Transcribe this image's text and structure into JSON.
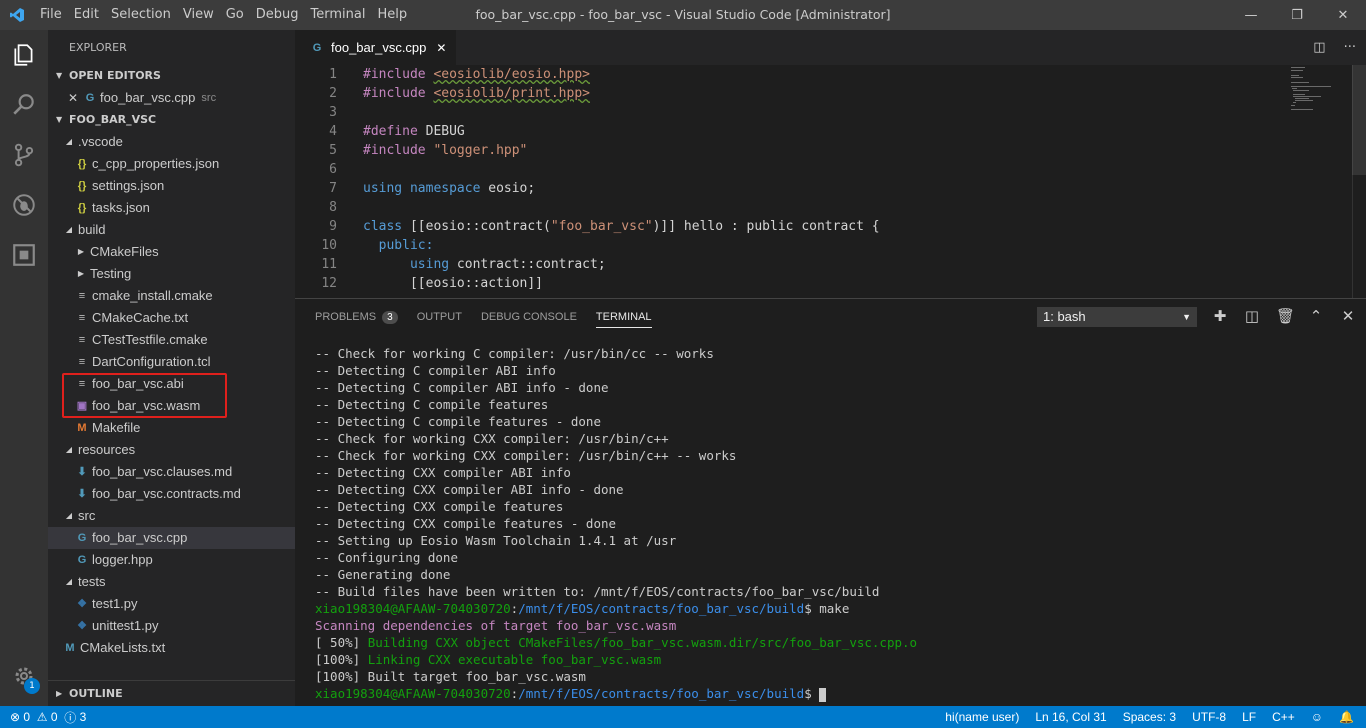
{
  "titlebar": {
    "menu": [
      "File",
      "Edit",
      "Selection",
      "View",
      "Go",
      "Debug",
      "Terminal",
      "Help"
    ],
    "title": "foo_bar_vsc.cpp - foo_bar_vsc - Visual Studio Code [Administrator]"
  },
  "activitybar": {
    "icons": [
      "explorer-icon",
      "search-icon",
      "source-control-icon",
      "debug-icon",
      "extensions-icon"
    ],
    "settings_badge": "1"
  },
  "sidebar": {
    "title": "EXPLORER",
    "open_editors_label": "OPEN EDITORS",
    "open_editor_file": "foo_bar_vsc.cpp",
    "open_editor_dir": "src",
    "project_label": "FOO_BAR_VSC",
    "tree": [
      {
        "label": ".vscode",
        "type": "folder-open",
        "depth": 1
      },
      {
        "label": "c_cpp_properties.json",
        "type": "json",
        "depth": 2
      },
      {
        "label": "settings.json",
        "type": "json",
        "depth": 2
      },
      {
        "label": "tasks.json",
        "type": "json",
        "depth": 2
      },
      {
        "label": "build",
        "type": "folder-open",
        "depth": 1
      },
      {
        "label": "CMakeFiles",
        "type": "folder-closed",
        "depth": 2
      },
      {
        "label": "Testing",
        "type": "folder-closed",
        "depth": 2
      },
      {
        "label": "cmake_install.cmake",
        "type": "lines",
        "depth": 2
      },
      {
        "label": "CMakeCache.txt",
        "type": "lines",
        "depth": 2
      },
      {
        "label": "CTestTestfile.cmake",
        "type": "lines",
        "depth": 2
      },
      {
        "label": "DartConfiguration.tcl",
        "type": "lines",
        "depth": 2
      },
      {
        "label": "foo_bar_vsc.abi",
        "type": "lines",
        "depth": 2
      },
      {
        "label": "foo_bar_vsc.wasm",
        "type": "wasm",
        "depth": 2
      },
      {
        "label": "Makefile",
        "type": "make",
        "depth": 2
      },
      {
        "label": "resources",
        "type": "folder-open",
        "depth": 1
      },
      {
        "label": "foo_bar_vsc.clauses.md",
        "type": "md",
        "depth": 2
      },
      {
        "label": "foo_bar_vsc.contracts.md",
        "type": "md",
        "depth": 2
      },
      {
        "label": "src",
        "type": "folder-open",
        "depth": 1
      },
      {
        "label": "foo_bar_vsc.cpp",
        "type": "cpp",
        "depth": 2,
        "active": true
      },
      {
        "label": "logger.hpp",
        "type": "cpp",
        "depth": 2
      },
      {
        "label": "tests",
        "type": "folder-open",
        "depth": 1
      },
      {
        "label": "test1.py",
        "type": "py",
        "depth": 2
      },
      {
        "label": "unittest1.py",
        "type": "py",
        "depth": 2
      },
      {
        "label": "CMakeLists.txt",
        "type": "cmake",
        "depth": 1
      }
    ],
    "outline_label": "OUTLINE"
  },
  "editor": {
    "tab_label": "foo_bar_vsc.cpp",
    "lines": [
      {
        "n": "1",
        "html": "<span class=\"k-purp\">#include</span> <span class=\"k-str squig\">&lt;eosiolib/eosio.hpp&gt;</span>"
      },
      {
        "n": "2",
        "html": "<span class=\"k-purp\">#include</span> <span class=\"k-str squig\">&lt;eosiolib/print.hpp&gt;</span>"
      },
      {
        "n": "3",
        "html": ""
      },
      {
        "n": "4",
        "html": "<span class=\"k-purp\">#define</span> DEBUG"
      },
      {
        "n": "5",
        "html": "<span class=\"k-purp\">#include</span> <span class=\"k-str\">\"logger.hpp\"</span>"
      },
      {
        "n": "6",
        "html": ""
      },
      {
        "n": "7",
        "html": "<span class=\"k-blue\">using</span> <span class=\"k-blue\">namespace</span> eosio;"
      },
      {
        "n": "8",
        "html": ""
      },
      {
        "n": "9",
        "html": "<span class=\"k-blue\">class</span> [[eosio::contract(<span class=\"k-str\">\"foo_bar_vsc\"</span>)]] hello : public contract {"
      },
      {
        "n": "10",
        "html": "  <span class=\"k-blue\">public:</span>"
      },
      {
        "n": "11",
        "html": "      <span class=\"k-blue\">using</span> contract::contract;"
      },
      {
        "n": "12",
        "html": "      [[eosio::action]]"
      }
    ]
  },
  "panel": {
    "tabs": [
      "PROBLEMS",
      "OUTPUT",
      "DEBUG CONSOLE",
      "TERMINAL"
    ],
    "problems_count": "3",
    "terminal_select": "1: bash",
    "terminal_lines": [
      {
        "cls": "",
        "text": "-- Check for working C compiler: /usr/bin/cc -- works"
      },
      {
        "cls": "",
        "text": "-- Detecting C compiler ABI info"
      },
      {
        "cls": "",
        "text": "-- Detecting C compiler ABI info - done"
      },
      {
        "cls": "",
        "text": "-- Detecting C compile features"
      },
      {
        "cls": "",
        "text": "-- Detecting C compile features - done"
      },
      {
        "cls": "",
        "text": "-- Check for working CXX compiler: /usr/bin/c++"
      },
      {
        "cls": "",
        "text": "-- Check for working CXX compiler: /usr/bin/c++ -- works"
      },
      {
        "cls": "",
        "text": "-- Detecting CXX compiler ABI info"
      },
      {
        "cls": "",
        "text": "-- Detecting CXX compiler ABI info - done"
      },
      {
        "cls": "",
        "text": "-- Detecting CXX compile features"
      },
      {
        "cls": "",
        "text": "-- Detecting CXX compile features - done"
      },
      {
        "cls": "",
        "text": "-- Setting up Eosio Wasm Toolchain 1.4.1 at /usr"
      },
      {
        "cls": "",
        "text": "-- Configuring done"
      },
      {
        "cls": "",
        "text": "-- Generating done"
      },
      {
        "cls": "",
        "text": "-- Build files have been written to: /mnt/f/EOS/contracts/foo_bar_vsc/build"
      },
      {
        "cls": "prompt",
        "user": "xiao198304@AFAAW-704030720",
        "path": "/mnt/f/EOS/contracts/foo_bar_vsc/build",
        "cmd": "$ make"
      },
      {
        "cls": "t-mag",
        "text": "Scanning dependencies of target foo_bar_vsc.wasm"
      },
      {
        "cls": "mixed",
        "prefix": "[ 50%] ",
        "text": "Building CXX object CMakeFiles/foo_bar_vsc.wasm.dir/src/foo_bar_vsc.cpp.o"
      },
      {
        "cls": "mixed",
        "prefix": "[100%] ",
        "text": "Linking CXX executable foo_bar_vsc.wasm"
      },
      {
        "cls": "",
        "text": "[100%] Built target foo_bar_vsc.wasm"
      },
      {
        "cls": "prompt-cursor",
        "user": "xiao198304@AFAAW-704030720",
        "path": "/mnt/f/EOS/contracts/foo_bar_vsc/build",
        "cmd": "$ "
      }
    ]
  },
  "statusbar": {
    "errors": "0",
    "warnings": "0",
    "info": "3",
    "user": "hi(name user)",
    "position": "Ln 16, Col 31",
    "spaces": "Spaces: 3",
    "encoding": "UTF-8",
    "eol": "LF",
    "language": "C++"
  }
}
